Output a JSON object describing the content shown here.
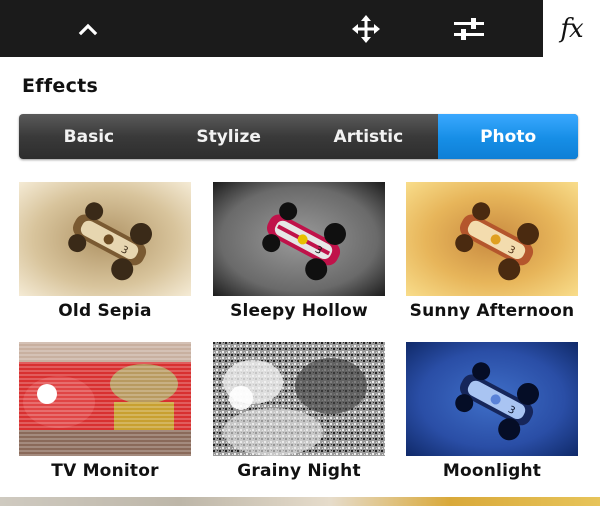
{
  "toolbar": {
    "items": [
      {
        "icon": "chevron-up-icon"
      },
      {
        "icon": "move-icon"
      },
      {
        "icon": "sliders-icon"
      },
      {
        "icon": "fx-icon",
        "label": "fx",
        "active": true
      }
    ]
  },
  "panel": {
    "title": "Effects"
  },
  "tabs": [
    {
      "label": "Basic",
      "active": false
    },
    {
      "label": "Stylize",
      "active": false
    },
    {
      "label": "Artistic",
      "active": false
    },
    {
      "label": "Photo",
      "active": true
    }
  ],
  "effects": [
    {
      "label": "Old Sepia"
    },
    {
      "label": "Sleepy Hollow"
    },
    {
      "label": "Sunny Afternoon"
    },
    {
      "label": "TV Monitor"
    },
    {
      "label": "Grainy Night"
    },
    {
      "label": "Moonlight"
    }
  ],
  "colors": {
    "toolbar_bg": "#1b1b1b",
    "tab_active": "#168ee6",
    "tab_inactive": "#3a3a3a"
  }
}
